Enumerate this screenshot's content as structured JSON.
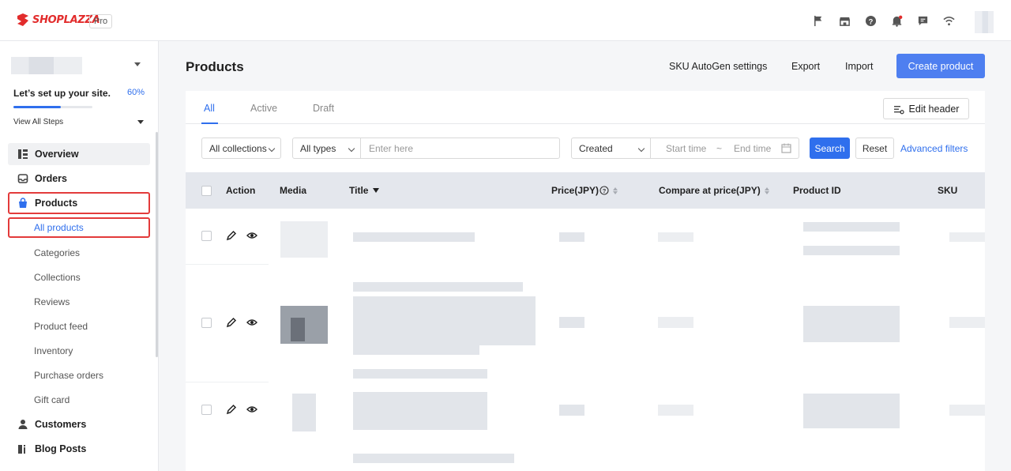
{
  "topbar": {
    "logo_text": "SHOPLAZZA",
    "plan_badge": "Pro",
    "icons": [
      "flag-icon",
      "store-icon",
      "help-icon",
      "bell-icon",
      "chat-icon",
      "wifi-icon"
    ],
    "notification_dot_color": "#e22c2c"
  },
  "sidebar": {
    "setup_text": "Let’s set up your site.",
    "setup_percent_label": "60%",
    "setup_progress": 0.6,
    "view_steps": "View All Steps",
    "nav": {
      "overview": "Overview",
      "orders": "Orders",
      "products": "Products",
      "customers": "Customers",
      "blog_posts": "Blog Posts"
    },
    "sub": {
      "all_products": "All products",
      "categories": "Categories",
      "collections": "Collections",
      "reviews": "Reviews",
      "product_feed": "Product feed",
      "inventory": "Inventory",
      "purchase_orders": "Purchase orders",
      "gift_card": "Gift card"
    }
  },
  "header": {
    "title": "Products",
    "sku_autogen": "SKU AutoGen settings",
    "export": "Export",
    "import": "Import",
    "create": "Create product"
  },
  "tabs": {
    "all": "All",
    "active": "Active",
    "draft": "Draft",
    "edit_header": "Edit header"
  },
  "filters": {
    "collections": "All collections",
    "types": "All types",
    "search_placeholder": "Enter here",
    "date_field": "Created",
    "start_time": "Start time",
    "separator": "~",
    "end_time": "End time",
    "search": "Search",
    "reset": "Reset",
    "advanced": "Advanced filters"
  },
  "table": {
    "columns": {
      "action": "Action",
      "media": "Media",
      "title": "Title",
      "price": "Price(JPY)",
      "compare_price": "Compare at price(JPY)",
      "product_id": "Product ID",
      "sku": "SKU"
    }
  },
  "colors": {
    "primary": "#2f6fed",
    "create_button": "#4e7ff0",
    "highlight_outline": "#e33b3b",
    "brand": "#e22c2c"
  }
}
